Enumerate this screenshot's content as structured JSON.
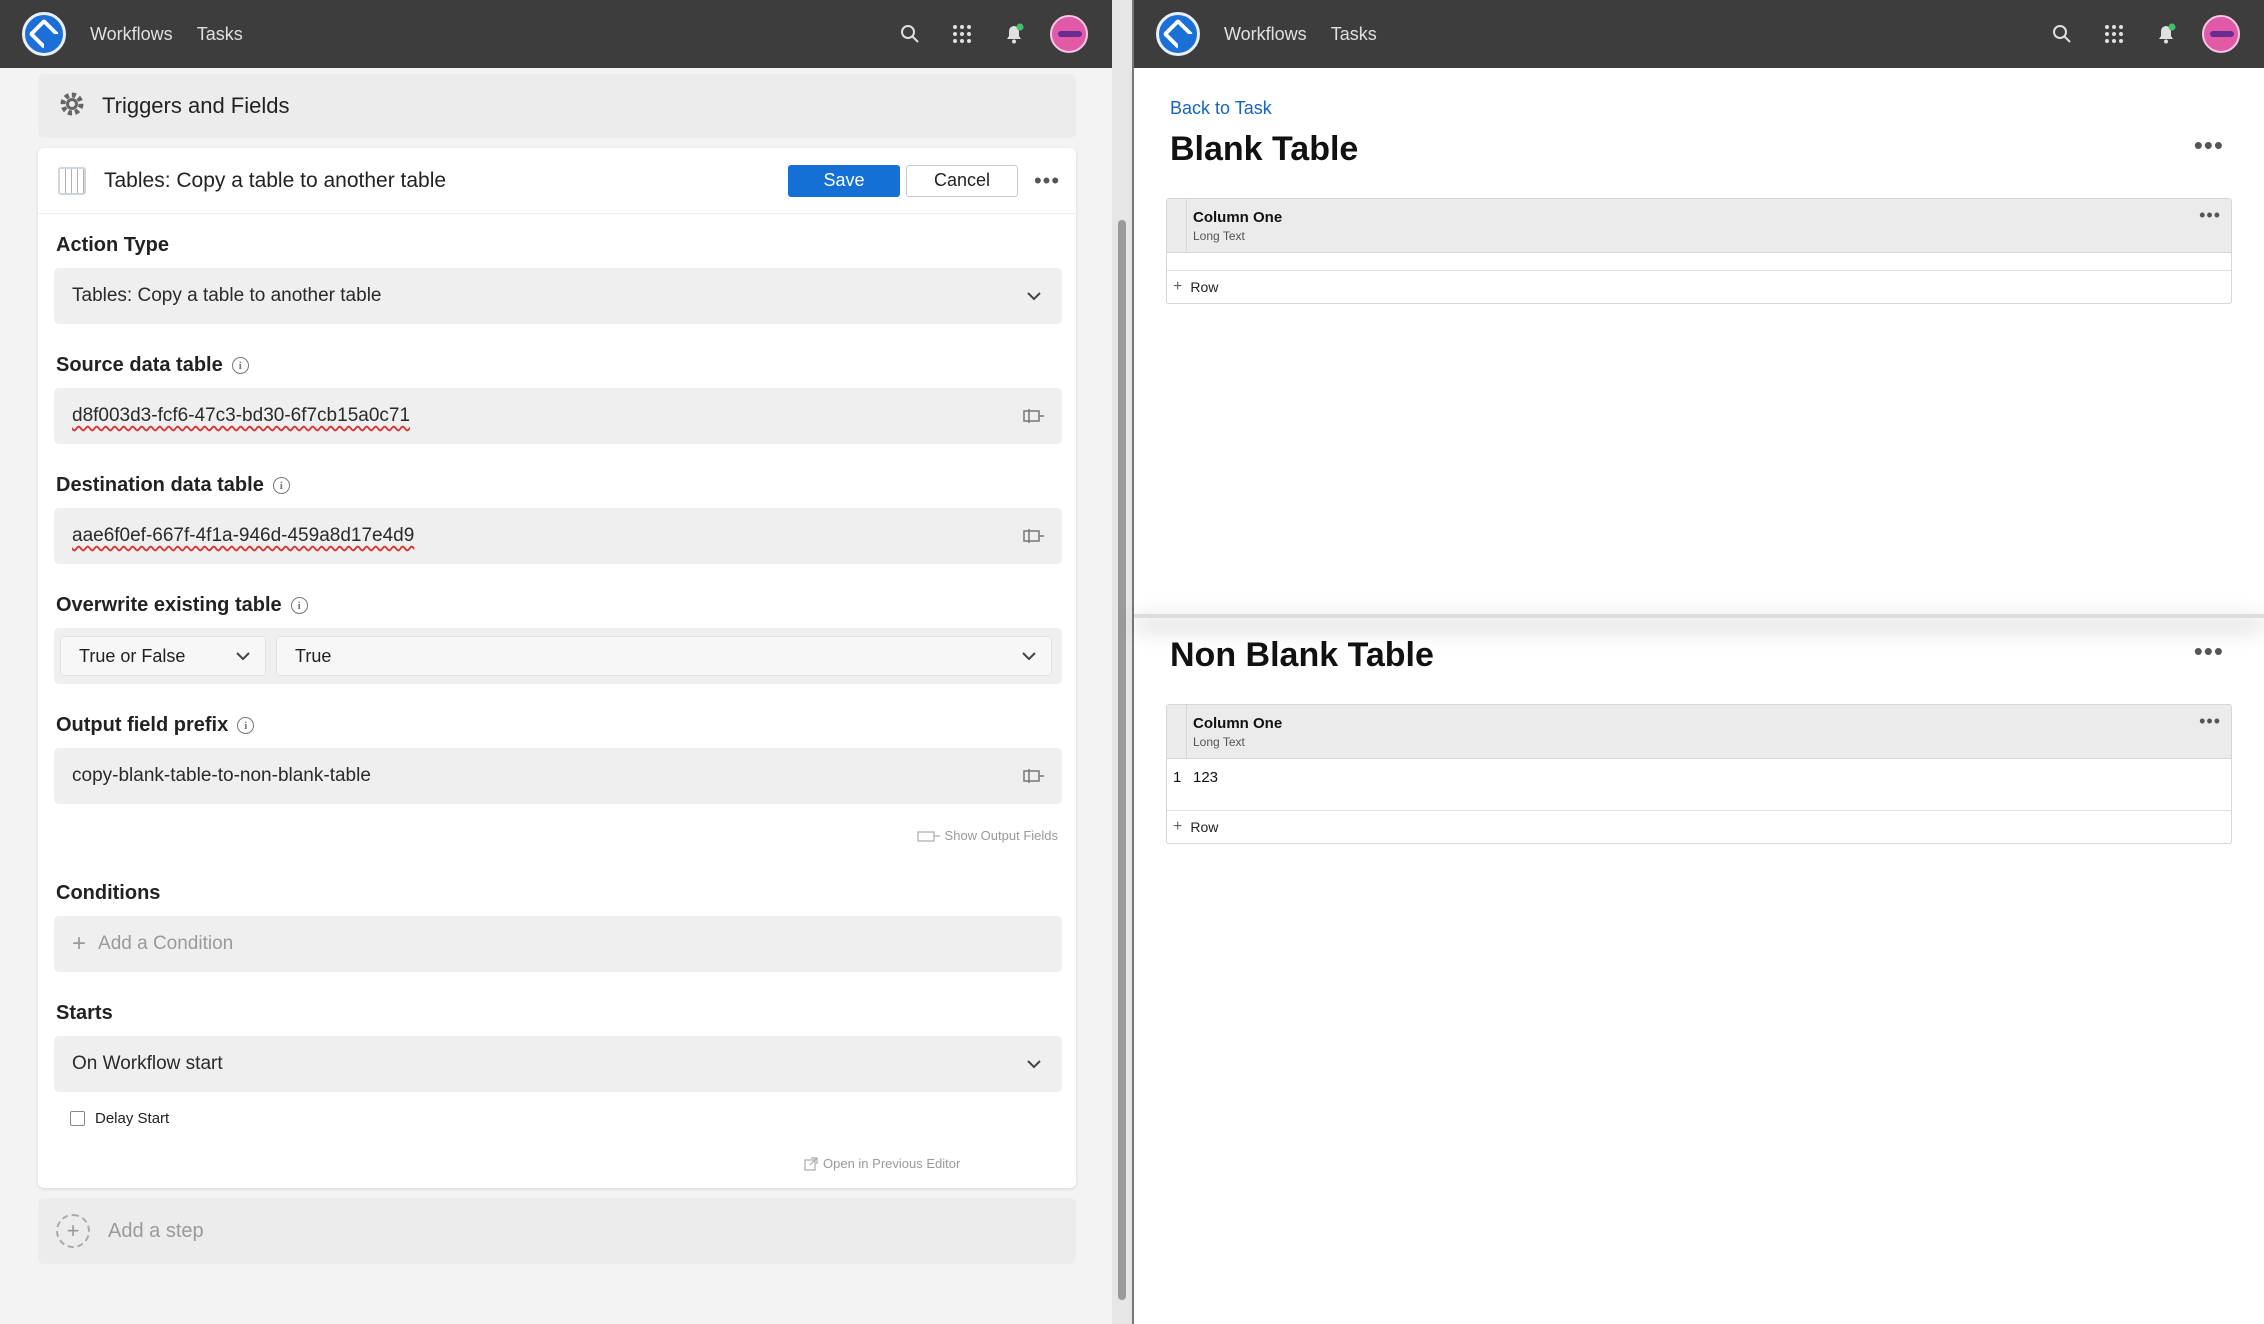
{
  "topbar": {
    "nav": [
      "Workflows",
      "Tasks"
    ]
  },
  "left": {
    "section_title": "Triggers and Fields",
    "step": {
      "title": "Tables: Copy a table to another table",
      "save_label": "Save",
      "cancel_label": "Cancel",
      "more_glyph": "•••"
    },
    "fields": {
      "action_type": {
        "label": "Action Type",
        "value": "Tables: Copy a table to another table"
      },
      "source": {
        "label": "Source data table",
        "value": "d8f003d3-fcf6-47c3-bd30-6f7cb15a0c71"
      },
      "destination": {
        "label": "Destination data table",
        "value": "aae6f0ef-667f-4f1a-946d-459a8d17e4d9"
      },
      "overwrite": {
        "label": "Overwrite existing table",
        "type_value": "True or False",
        "value": "True"
      },
      "prefix": {
        "label": "Output field prefix",
        "value": "copy-blank-table-to-non-blank-table"
      }
    },
    "show_output": "Show Output Fields",
    "conditions": {
      "label": "Conditions",
      "add_label": "Add a Condition"
    },
    "starts": {
      "label": "Starts",
      "value": "On Workflow start"
    },
    "delay_label": "Delay Start",
    "open_previous": "Open in Previous Editor",
    "add_step": "Add a step"
  },
  "right": {
    "back_link": "Back to Task",
    "tables": [
      {
        "title": "Blank Table",
        "column": {
          "name": "Column One",
          "type": "Long Text"
        },
        "rows": [],
        "add_row": "Row"
      },
      {
        "title": "Non Blank Table",
        "column": {
          "name": "Column One",
          "type": "Long Text"
        },
        "rows": [
          {
            "num": "1",
            "value": "123"
          }
        ],
        "add_row": "Row"
      }
    ]
  }
}
